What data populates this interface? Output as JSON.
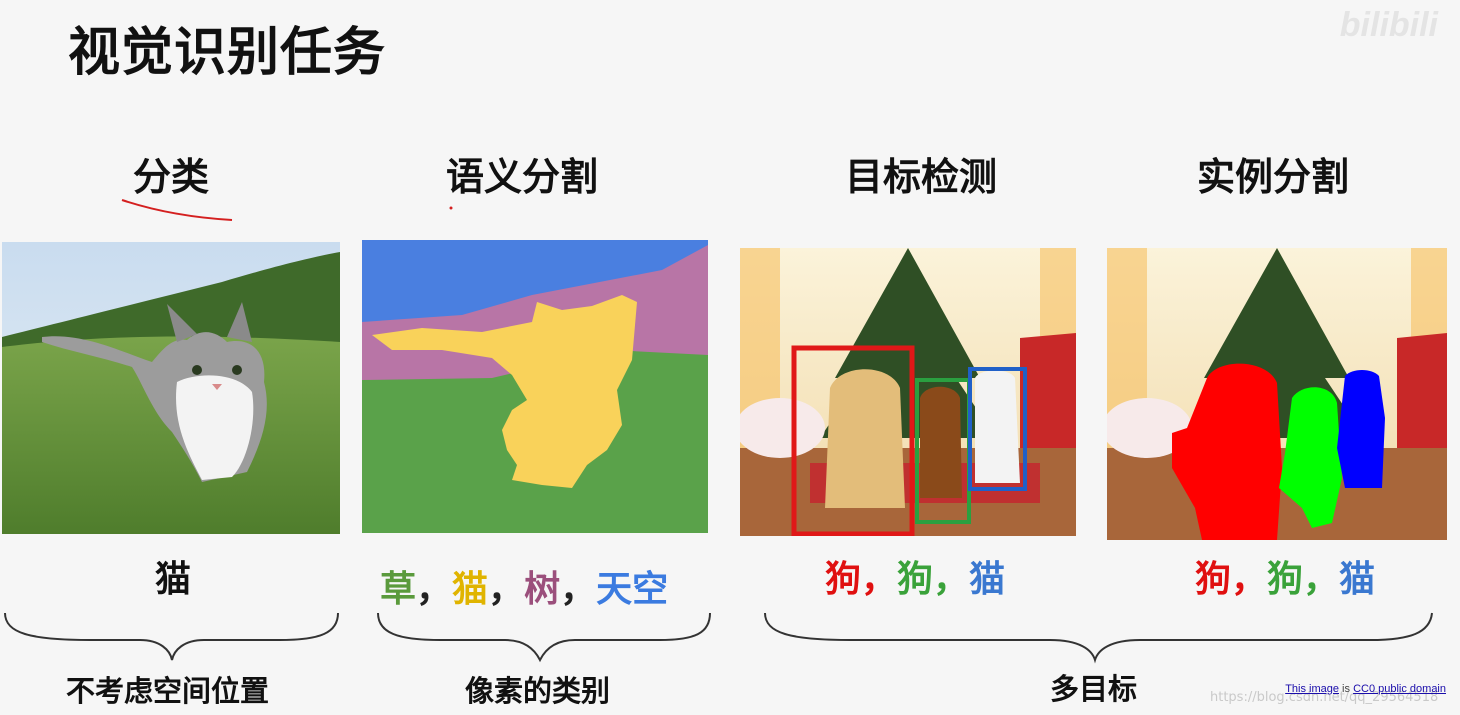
{
  "slide": {
    "title": "视觉识别任务",
    "watermark_logo": "bilibili",
    "watermark_text": "https://blog.csdn.net/qq_29564518",
    "credit_link": "This image",
    "credit_is": "is",
    "credit_license": "CC0 public domain"
  },
  "tasks": [
    {
      "label": "分类"
    },
    {
      "label": "语义分割"
    },
    {
      "label": "目标检测"
    },
    {
      "label": "实例分割"
    }
  ],
  "captions": {
    "classification": "猫",
    "semantic": [
      {
        "text": "草",
        "color": "#5a9a3c"
      },
      {
        "text": "，",
        "color": "#222222"
      },
      {
        "text": "猫",
        "color": "#e0b400"
      },
      {
        "text": "，",
        "color": "#222222"
      },
      {
        "text": "树",
        "color": "#9b4f7c"
      },
      {
        "text": "，",
        "color": "#222222"
      },
      {
        "text": "天空",
        "color": "#3b7be0"
      }
    ],
    "detection": [
      {
        "text": "狗",
        "color": "#e01010"
      },
      {
        "text": "，",
        "color": "#e01010"
      },
      {
        "text": "狗",
        "color": "#3aa23a"
      },
      {
        "text": "，",
        "color": "#3aa23a"
      },
      {
        "text": "猫",
        "color": "#3a78d0"
      }
    ],
    "instance": [
      {
        "text": "狗",
        "color": "#e01010"
      },
      {
        "text": "，",
        "color": "#e01010"
      },
      {
        "text": "狗",
        "color": "#3aa23a"
      },
      {
        "text": "，",
        "color": "#3aa23a"
      },
      {
        "text": "猫",
        "color": "#3a78d0"
      }
    ]
  },
  "bottom_labels": {
    "classification": "不考虑空间位置",
    "semantic": "像素的类别",
    "multi": "多目标"
  },
  "colors": {
    "sky": "#4a7fe0",
    "tree": "#b875a6",
    "grass": "#5aa24a",
    "cat": "#f9d25a",
    "box_red": "#e01818",
    "box_green": "#2aa040",
    "box_blue": "#2060c8",
    "mask_red": "#ff0000",
    "mask_green": "#00ff00",
    "mask_blue": "#0000ff"
  }
}
